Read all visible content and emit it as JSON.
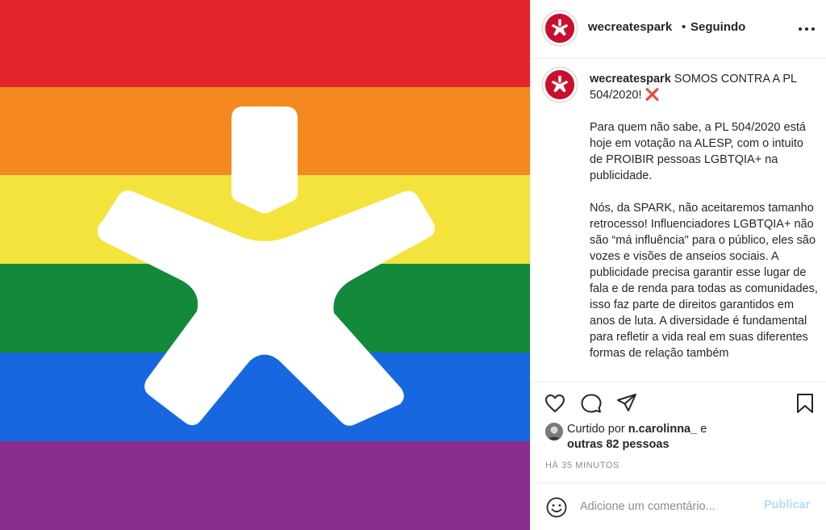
{
  "post_image": {
    "stripe_colors": [
      "#e5252c",
      "#f5881f",
      "#f5e33d",
      "#138a3b",
      "#1767e0",
      "#8b2c8f"
    ],
    "logo": "spark-star-logo"
  },
  "header": {
    "username": "wecreatespark",
    "separator": "•",
    "follow_status": "Seguindo",
    "more_icon": "more-horizontal-icon"
  },
  "caption": {
    "username": "wecreatespark",
    "title": "SOMOS CONTRA A PL 504/2020!",
    "title_emoji": "❌",
    "paragraph1": "Para quem não sabe, a PL 504/2020 está hoje em votação na ALESP, com o intuito de PROIBIR pessoas LGBTQIA+ na publicidade.",
    "paragraph2": "Nós, da SPARK, não aceitaremos tamanho retrocesso! Influenciadores LGBTQIA+ não são “má influência\" para o público, eles são vozes e visões de anseios sociais. A publicidade precisa garantir esse lugar de fala e de renda para todas as comunidades, isso faz parte de direitos garantidos em anos de luta. A diversidade é fundamental para refletir a vida real em suas diferentes formas de relação também"
  },
  "actions": {
    "like_icon": "heart-icon",
    "comment_icon": "comment-icon",
    "share_icon": "paper-plane-icon",
    "save_icon": "bookmark-icon"
  },
  "likes": {
    "prefix": "Curtido por",
    "liker": "n.carolinna_",
    "conjunction": "e",
    "others": "outras 82 pessoas"
  },
  "timestamp": "HÁ 35 MINUTOS",
  "comment": {
    "placeholder": "Adicione um comentário...",
    "publish_label": "Publicar",
    "emoji_icon": "smile-icon"
  },
  "colors": {
    "brand_red": "#c8102e",
    "publish_disabled": "#b2dffc",
    "muted_text": "#8e8e8e"
  }
}
